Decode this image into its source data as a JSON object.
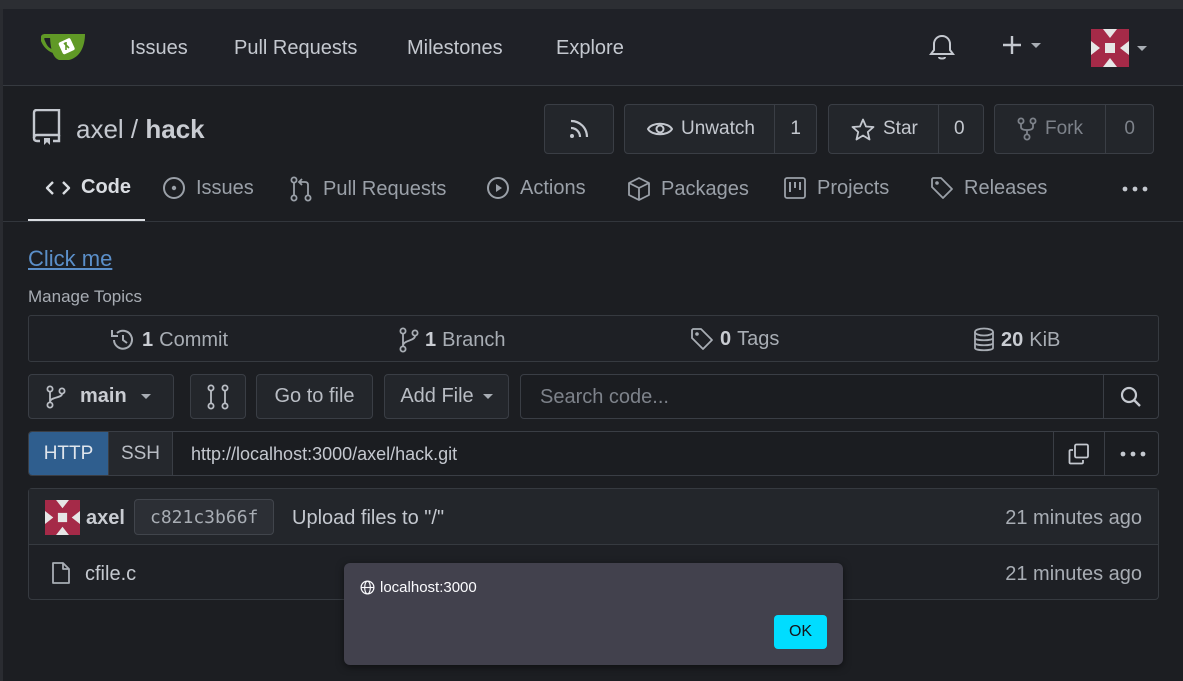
{
  "navbar": {
    "items": [
      "Issues",
      "Pull Requests",
      "Milestones",
      "Explore"
    ]
  },
  "repo": {
    "owner": "axel",
    "separator": " / ",
    "name": "hack",
    "unwatch_label": "Unwatch",
    "watch_count": "1",
    "star_label": "Star",
    "star_count": "0",
    "fork_label": "Fork",
    "fork_count": "0"
  },
  "tabs": {
    "code": "Code",
    "issues": "Issues",
    "pulls": "Pull Requests",
    "actions": "Actions",
    "packages": "Packages",
    "projects": "Projects",
    "releases": "Releases"
  },
  "content": {
    "link_text": "Click me",
    "manage_topics": "Manage Topics"
  },
  "stats": {
    "commits_count": "1",
    "commits_label": "Commit",
    "branches_count": "1",
    "branches_label": "Branch",
    "tags_count": "0",
    "tags_label": "Tags",
    "size_count": "20",
    "size_label": "KiB"
  },
  "toolbar": {
    "branch": "main",
    "go_to_file": "Go to file",
    "add_file": "Add File",
    "search_placeholder": "Search code..."
  },
  "clone": {
    "http": "HTTP",
    "ssh": "SSH",
    "url": "http://localhost:3000/axel/hack.git"
  },
  "commit": {
    "author": "axel",
    "sha": "c821c3b66f",
    "message": "Upload files to \"/\"",
    "time": "21 minutes ago"
  },
  "files": [
    {
      "name": "cfile.c",
      "time": "21 minutes ago"
    }
  ],
  "dialog": {
    "origin": "localhost:3000",
    "ok": "OK",
    "ok_color": "#00ddff"
  },
  "colors": {
    "background": "#1c1e22",
    "accent_http": "#2f5e8e",
    "link": "#5b8fc9",
    "logo_green": "#609926"
  }
}
